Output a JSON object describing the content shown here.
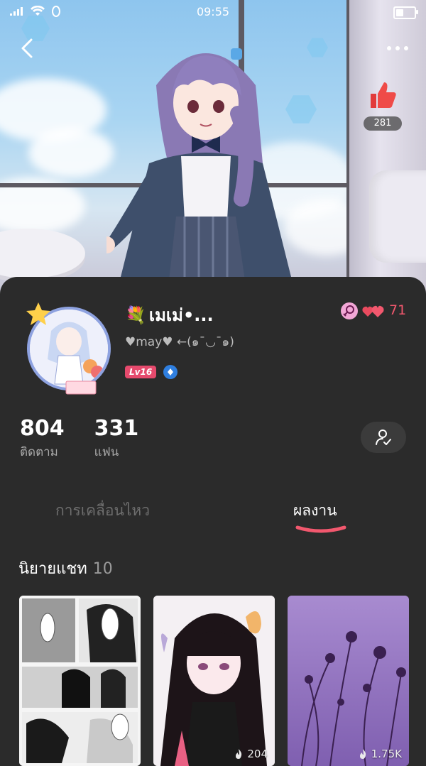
{
  "status_bar": {
    "time": "09:55"
  },
  "banner": {
    "likes_count": "281"
  },
  "profile": {
    "username": "เมเม่•...",
    "bio": "♥may♥ ←(๑¯◡¯๑)",
    "level": "Lv16",
    "hearts_count": "71"
  },
  "stats": {
    "following": {
      "value": "804",
      "label": "ติดตาม"
    },
    "fans": {
      "value": "331",
      "label": "แฟน"
    }
  },
  "tabs": [
    {
      "label": "การเคลื่อนไหว",
      "active": false
    },
    {
      "label": "ผลงาน",
      "active": true
    }
  ],
  "section": {
    "title": "นิยายแชท",
    "count": "10"
  },
  "cards": [
    {
      "name": "manga-panels",
      "count": ""
    },
    {
      "name": "anime-girl-butterfly",
      "count": "204"
    },
    {
      "name": "purple-flowers",
      "count": "1.75K"
    }
  ],
  "colors": {
    "accent": "#f2586e",
    "panel": "#2b2b2b",
    "level_badge": "#e64a6d"
  },
  "icons": [
    "back-icon",
    "more-icon",
    "thumbs-up-icon",
    "gender-icon",
    "hearts-icon",
    "verified-icon",
    "follow-user-icon",
    "fire-icon"
  ]
}
